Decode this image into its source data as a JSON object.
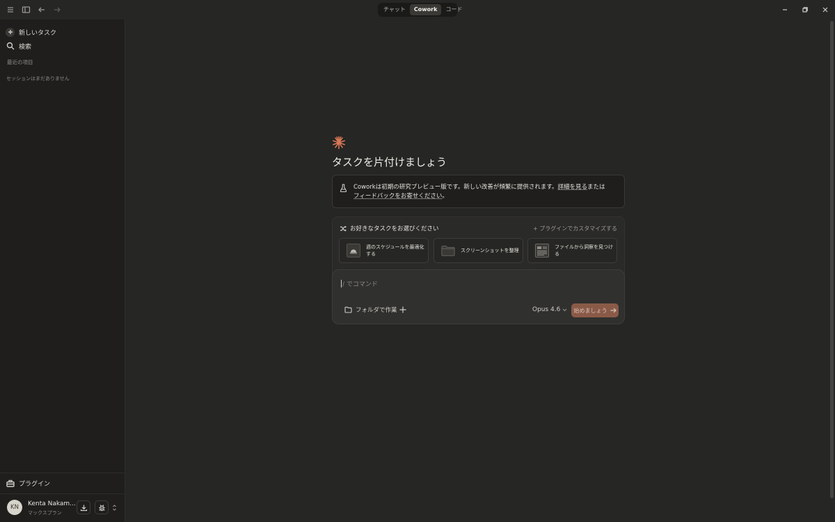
{
  "topbar": {
    "mode_tabs": [
      {
        "label": "チャット",
        "active": false
      },
      {
        "label": "Cowork",
        "active": true
      },
      {
        "label": "コード",
        "active": false
      }
    ],
    "icons": [
      "menu-icon",
      "sidebar-toggle-icon",
      "back-arrow-icon",
      "forward-arrow-icon"
    ],
    "window_controls": [
      "minimize-icon",
      "restore-icon",
      "close-icon"
    ]
  },
  "sidebar": {
    "new_task": "新しいタスク",
    "search": "検索",
    "recent_heading": "最近の項目",
    "empty_sessions": "セッションはまだありません",
    "plugins": "プラグイン",
    "user": {
      "initials": "KN",
      "name": "Kenta Nakam...",
      "plan": "マックスプラン"
    }
  },
  "main": {
    "headline": "タスクを片付けましょう",
    "info": {
      "brand": "Cowork",
      "text1": "は初期の研究プレビュー版です。新しい改善が頻繁に提供されます。",
      "link1": "詳細を見る",
      "text2": "または",
      "link2": "フィードバックをお寄せください",
      "text3": "。"
    },
    "tasks": {
      "title": "お好きなタスクをお選びください",
      "plugin_customize": "+ プラグインでカスタマイズする",
      "cards": [
        {
          "label": "週のスケジュールを最適化する",
          "icon": "calendar-icon"
        },
        {
          "label": "スクリーンショットを整理",
          "icon": "folder-icon"
        },
        {
          "label": "ファイルから洞察を見つける",
          "icon": "document-icon"
        }
      ]
    },
    "input": {
      "placeholder": "/ でコマンド",
      "folder_button": "フォルダで作業",
      "model": "Opus 4.6",
      "start_button": "始めましょう"
    }
  },
  "colors": {
    "background": "#262624",
    "sidebar": "#1f1e1d",
    "accent": "#d97757",
    "start_button": "#8a5a48"
  }
}
